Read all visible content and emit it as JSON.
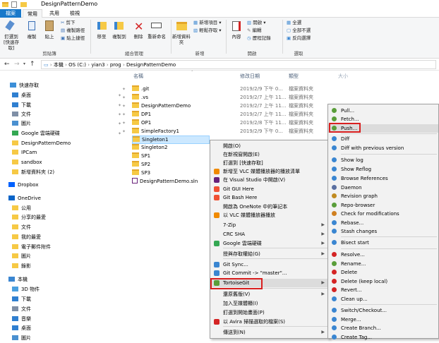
{
  "window": {
    "title": "DesignPatternDemo"
  },
  "ribbon": {
    "tabs": [
      "檔案",
      "常用",
      "共用",
      "檢視"
    ],
    "clipboard": {
      "pin": "釘選到 [快速存取]",
      "copy": "複製",
      "paste": "貼上",
      "cut": "剪下",
      "copy_path": "複製路徑",
      "paste_shortcut": "貼上捷徑",
      "label": "剪貼簿"
    },
    "organize": {
      "move": "移至",
      "copy_to": "複製到",
      "delete": "刪除",
      "rename": "重新命名",
      "label": "組合管理"
    },
    "new": {
      "new_folder": "新增資料夾",
      "new_item": "新增項目 ▾",
      "easy_access": "輕鬆存取 ▾",
      "label": "新增"
    },
    "open": {
      "properties": "內容",
      "open": "開啟 ▾",
      "edit": "編輯",
      "history": "歷程記錄",
      "label": "開啟"
    },
    "select": {
      "all": "全選",
      "none": "全部不選",
      "invert": "反向選擇",
      "label": "選取"
    }
  },
  "address": {
    "segments": [
      "本機",
      "OS (C:)",
      "yian3",
      "prog",
      "DesignPatternDemo"
    ]
  },
  "nav": {
    "items": [
      {
        "label": "快速存取",
        "color": "#3c8fd8"
      },
      {
        "label": "桌面",
        "color": "#2f7fd0"
      },
      {
        "label": "下載",
        "color": "#2f7fd0"
      },
      {
        "label": "文件",
        "color": "#7f8fa6"
      },
      {
        "label": "圖片",
        "color": "#4a90d0"
      },
      {
        "label": "Google 雲端硬碟",
        "color": "#34a853"
      },
      {
        "label": "DesignPatternDemo",
        "color": "#f6c945"
      },
      {
        "label": "IPCam",
        "color": "#f6c945"
      },
      {
        "label": "sandbox",
        "color": "#f6c945"
      },
      {
        "label": "新增資料夾 (2)",
        "color": "#f6c945"
      },
      {
        "label": "Dropbox",
        "color": "#0061fe"
      },
      {
        "label": "OneDrive",
        "color": "#0a64c8"
      },
      {
        "label": "公用",
        "color": "#f6c945"
      },
      {
        "label": "分享的最愛",
        "color": "#f6c945"
      },
      {
        "label": "文件",
        "color": "#f6c945"
      },
      {
        "label": "我的最愛",
        "color": "#f6c945"
      },
      {
        "label": "電子郵件附件",
        "color": "#f6c945"
      },
      {
        "label": "圖片",
        "color": "#f6c945"
      },
      {
        "label": "錄影",
        "color": "#f6c945"
      },
      {
        "label": "本機",
        "color": "#3a86d1"
      },
      {
        "label": "3D 物件",
        "color": "#4aa0e0"
      },
      {
        "label": "下載",
        "color": "#2f7fd0"
      },
      {
        "label": "文件",
        "color": "#7f8fa6"
      },
      {
        "label": "音樂",
        "color": "#2f7fd0"
      },
      {
        "label": "桌面",
        "color": "#2f7fd0"
      },
      {
        "label": "圖片",
        "color": "#4a90d0"
      }
    ]
  },
  "files": {
    "headers": {
      "name": "名稱",
      "date": "修改日期",
      "type": "類型",
      "size": "大小"
    },
    "rows": [
      {
        "name": ".git",
        "date": "2019/2/9 下午 0...",
        "type": "檔案資料夾"
      },
      {
        "name": ".vs",
        "date": "2019/2/7 上午 11...",
        "type": "檔案資料夾"
      },
      {
        "name": "DesignPatternDemo",
        "date": "2019/2/7 上午 11...",
        "type": "檔案資料夾"
      },
      {
        "name": "DP1",
        "date": "2019/2/7 上午 11...",
        "type": "檔案資料夾"
      },
      {
        "name": "OP1",
        "date": "2019/2/8 下午 11...",
        "type": "檔案資料夾"
      },
      {
        "name": "SimpleFactory1",
        "date": "2019/2/9 下午 0...",
        "type": "檔案資料夾"
      },
      {
        "name": "Singleton1",
        "date": "",
        "type": ""
      },
      {
        "name": "Singleton2",
        "date": "",
        "type": ""
      },
      {
        "name": "SP1",
        "date": "",
        "type": ""
      },
      {
        "name": "SP2",
        "date": "",
        "type": ""
      },
      {
        "name": "SP3",
        "date": "",
        "type": ""
      },
      {
        "name": "DesignPatternDemo.sln",
        "date": "",
        "type": ""
      }
    ]
  },
  "context_menu": {
    "items": [
      {
        "label": "開啟(O)"
      },
      {
        "label": "在新視窗開啟(E)"
      },
      {
        "label": "釘選到 [快速存取]"
      },
      {
        "label": "新增至 VLC 媒體播放器的播放清單"
      },
      {
        "label": "在 Visual Studio 中開啟(V)"
      },
      {
        "label": "Git GUI Here"
      },
      {
        "label": "Git Bash Here"
      },
      {
        "label": "開啟為 OneNote 中的筆記本"
      },
      {
        "label": "以 VLC 媒體播放器播放"
      },
      {
        "label": "7-Zip"
      },
      {
        "label": "CRC SHA"
      },
      {
        "label": "Google 雲端硬碟"
      },
      {
        "label": "授與存取權給(G)"
      },
      {
        "label": "Git Sync..."
      },
      {
        "label": "Git Commit -> \"master\"..."
      },
      {
        "label": "TortoiseGit"
      },
      {
        "label": "還原舊版(V)"
      },
      {
        "label": "加入至媒體櫃(I)"
      },
      {
        "label": "釘選到開始畫面(P)"
      },
      {
        "label": "以 Avira 掃描選取的檔案(S)"
      },
      {
        "label": "傳送到(N)"
      }
    ]
  },
  "submenu": {
    "items": [
      {
        "label": "Pull..."
      },
      {
        "label": "Fetch..."
      },
      {
        "label": "Push..."
      },
      {
        "label": "Diff"
      },
      {
        "label": "Diff with previous version"
      },
      {
        "label": "Show log"
      },
      {
        "label": "Show Reflog"
      },
      {
        "label": "Browse References"
      },
      {
        "label": "Daemon"
      },
      {
        "label": "Revision graph"
      },
      {
        "label": "Repo-browser"
      },
      {
        "label": "Check for modifications"
      },
      {
        "label": "Rebase..."
      },
      {
        "label": "Stash changes"
      },
      {
        "label": "Bisect start"
      },
      {
        "label": "Resolve..."
      },
      {
        "label": "Rename..."
      },
      {
        "label": "Delete"
      },
      {
        "label": "Delete (keep local)"
      },
      {
        "label": "Revert..."
      },
      {
        "label": "Clean up..."
      },
      {
        "label": "Switch/Checkout..."
      },
      {
        "label": "Merge..."
      },
      {
        "label": "Create Branch..."
      },
      {
        "label": "Create Tag..."
      }
    ]
  },
  "colors": {
    "accent": "#1979ca",
    "highlight_box": "#d92020",
    "selected_row": "#cce8ff"
  }
}
